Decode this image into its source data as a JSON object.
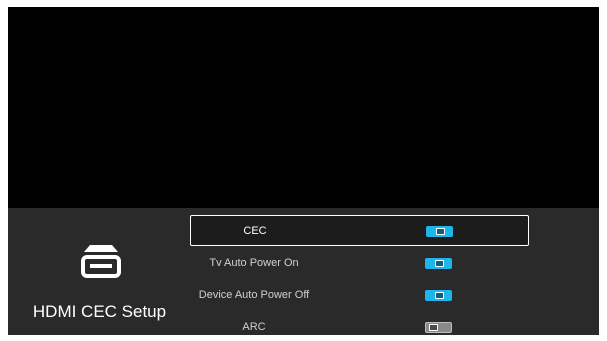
{
  "section": {
    "title": "HDMI CEC Setup",
    "icon": "hdmi-port-icon"
  },
  "settings": [
    {
      "label": "CEC",
      "state": "on",
      "focused": true
    },
    {
      "label": "Tv Auto Power On",
      "state": "on",
      "focused": false
    },
    {
      "label": "Device Auto Power Off",
      "state": "on",
      "focused": false
    },
    {
      "label": "ARC",
      "state": "off",
      "focused": false
    }
  ],
  "colors": {
    "toggle_on": "#1eb6ea",
    "toggle_off": "#8a8a8a",
    "panel_bg": "#2a2a2a",
    "focus_border": "#ffffff"
  }
}
